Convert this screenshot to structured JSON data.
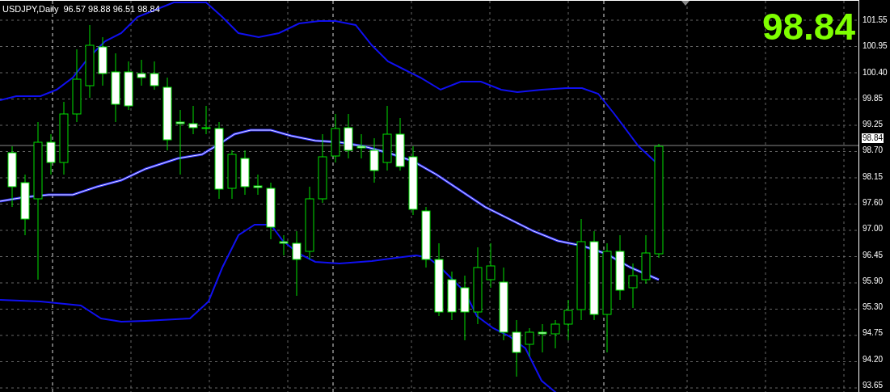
{
  "chart": {
    "symbol_info": "USDJPY,Daily",
    "ohlc": "96.57 98.88 96.51 98.84",
    "current_price": "98.84"
  },
  "price_axis": {
    "labels": [
      "101.55",
      "100.95",
      "100.40",
      "99.85",
      "99.25",
      "98.70",
      "98.15",
      "97.60",
      "97.00",
      "96.45",
      "95.90",
      "95.30",
      "94.75",
      "94.20",
      "93.65"
    ],
    "current_price_tag": "98.84"
  }
}
